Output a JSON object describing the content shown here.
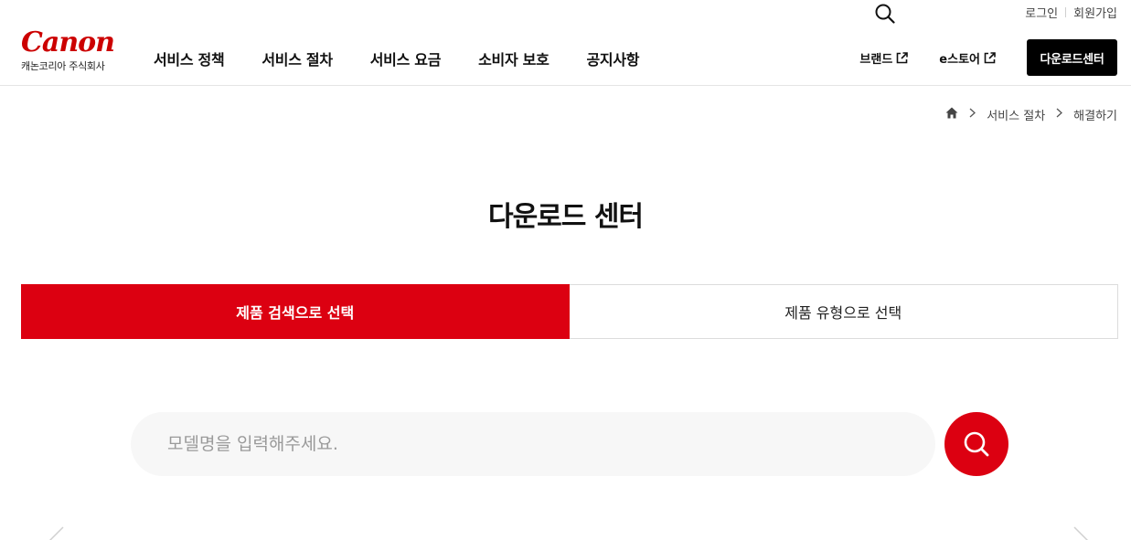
{
  "brand": {
    "wordmark": "Canon",
    "subtitle": "캐논코리아 주식회사"
  },
  "utility": {
    "login": "로그인",
    "signup": "회원가입"
  },
  "gnb": {
    "items": [
      {
        "label": "서비스 정책"
      },
      {
        "label": "서비스 절차"
      },
      {
        "label": "서비스 요금"
      },
      {
        "label": "소비자 보호"
      },
      {
        "label": "공지사항"
      }
    ]
  },
  "side_nav": {
    "brand": "브랜드",
    "estore": "e스토어",
    "download_center": "다운로드센터"
  },
  "breadcrumb": {
    "level1": "서비스 절차",
    "level2": "해결하기"
  },
  "page": {
    "title": "다운로드 센터"
  },
  "tabs": [
    {
      "label": "제품 검색으로 선택",
      "active": true
    },
    {
      "label": "제품 유형으로 선택",
      "active": false
    }
  ],
  "search": {
    "placeholder": "모델명을 입력해주세요.",
    "value": ""
  },
  "colors": {
    "brand_red": "#dc0011",
    "logo_red": "#cc0000",
    "button_black": "#000000",
    "search_bg": "#f7f7f7"
  },
  "icons": {
    "util_search": "search-icon",
    "external": "external-link-icon",
    "home": "home-icon",
    "chevron": "chevron-right-icon",
    "search_submit": "search-icon"
  }
}
